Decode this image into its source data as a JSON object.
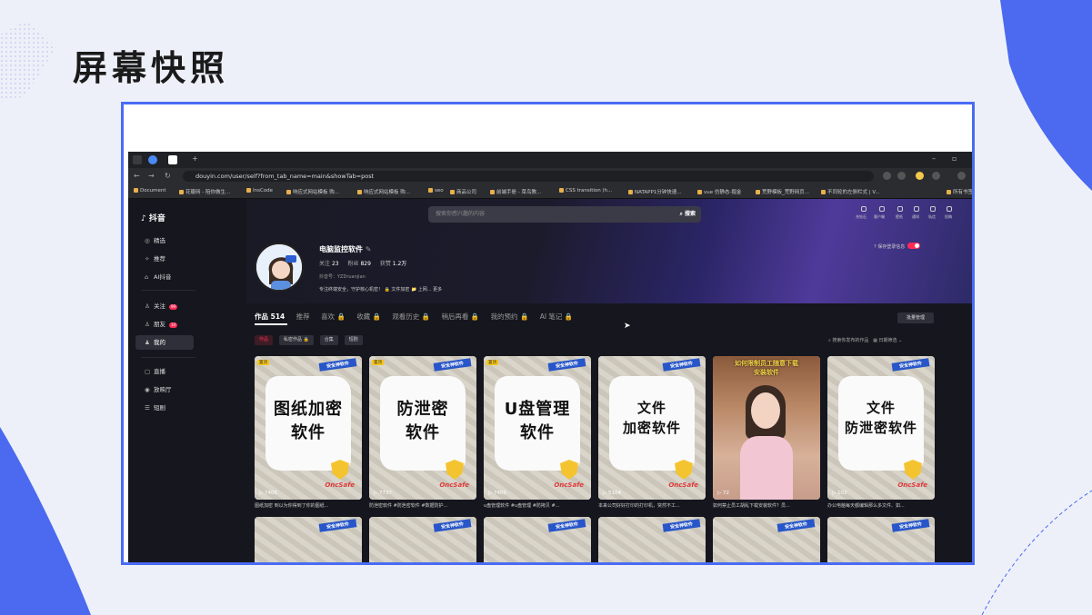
{
  "slide": {
    "title": "屏幕快照"
  },
  "browser": {
    "url": "douyin.com/user/self?from_tab_name=main&showTab=post",
    "bookmarks": [
      "Document",
      "花瓣网 - 陪你做生...",
      "InsCode",
      "响应式网站模板 购...",
      "响应式网站模板 购...",
      "seo",
      "商品公司",
      "前端手册 - 菜鸟教...",
      "CSS transition (h...",
      "NATAPP1分钟快速...",
      "vue 仿静态-掘金",
      "荒野模板_荒野网页...",
      "不同轮的左侧栏式 | V...",
      "所有书签"
    ]
  },
  "douyin": {
    "logo": "抖音",
    "search_placeholder": "搜索你感兴趣的内容",
    "search_button": "搜索",
    "top_icons": [
      "充钻石",
      "客户端",
      "壁纸",
      "通知",
      "私信",
      "投稿"
    ],
    "sidebar": [
      {
        "label": "精选",
        "icon": "◎"
      },
      {
        "label": "推荐",
        "icon": "✧"
      },
      {
        "label": "AI抖音",
        "icon": "⌂"
      },
      {
        "label": "关注",
        "icon": "♙",
        "badge": "99"
      },
      {
        "label": "朋友",
        "icon": "♙",
        "badge": "10"
      },
      {
        "label": "我的",
        "icon": "♟"
      },
      {
        "label": "直播",
        "icon": "▢"
      },
      {
        "label": "放映厅",
        "icon": "◉"
      },
      {
        "label": "短剧",
        "icon": "☰"
      }
    ],
    "profile": {
      "name": "电脑监控软件",
      "follow_label": "关注",
      "follow": "23",
      "fans_label": "粉丝",
      "fans": "829",
      "likes_label": "获赞",
      "likes": "1.2万",
      "id": "抖音号：YZDruanjian",
      "bio": "专注终端安全，守护核心机密！ 🔒 文件加密 📁 上网... 更多",
      "privacy_label": "保存登录信息"
    },
    "tabs": [
      "作品 514",
      "推荐",
      "喜欢 🔒",
      "收藏 🔒",
      "观看历史 🔒",
      "稍后再看 🔒",
      "我的预约 🔒",
      "AI 笔记 🔒"
    ],
    "manage_button": "批量管理",
    "chips": [
      "作品",
      "私密作品 🔒",
      "合集",
      "短剧"
    ],
    "filter": {
      "search": "搜索你发布的作品",
      "date": "日期筛选 ⌄"
    },
    "cards": [
      {
        "title_lines": [
          "图纸加密",
          "软件"
        ],
        "tag": "置顶",
        "plays": "▷ 7405",
        "caption": "图纸加密 到以为你得到了你的图纸..."
      },
      {
        "title_lines": [
          "防泄密",
          "软件"
        ],
        "tag": "置顶",
        "plays": "▷ 7737",
        "caption": "防泄密软件 #防泄密软件 #数据防护..."
      },
      {
        "title_lines": [
          "U盘管理",
          "软件"
        ],
        "tag": "置顶",
        "plays": "▷ 7405",
        "caption": "u盘管理软件 #u盘管理 #防拷贝 #..."
      },
      {
        "title_lines": [
          "文件",
          "加密软件"
        ],
        "tag": "",
        "plays": "▷ 5104",
        "caption": "本来公司好好打印的打印机，突然不工..."
      },
      {
        "title_lines": [
          "如何限制员工随意下载",
          "安装软件"
        ],
        "tag": "",
        "plays": "▷ 72",
        "caption": "如何禁止员工胡乱下载安装软件？员..."
      },
      {
        "title_lines": [
          "文件",
          "防泄密软件"
        ],
        "tag": "",
        "plays": "▷ 103",
        "caption": "办公电脑每天都编辑那么多文件、如..."
      }
    ],
    "card_banner": "安全神软件",
    "card_brand": "OncSafe"
  }
}
